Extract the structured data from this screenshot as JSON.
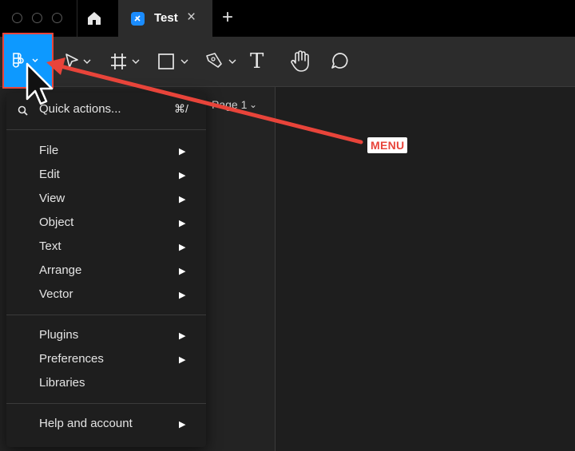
{
  "tabbar": {
    "tab_title": "Test",
    "close_glyph": "×",
    "new_tab_glyph": "+"
  },
  "toolbar": {
    "icons": [
      "figma-logo-icon",
      "move-tool-icon",
      "frame-tool-icon",
      "shape-tool-icon",
      "pen-tool-icon",
      "text-tool-icon",
      "hand-tool-icon",
      "comment-tool-icon"
    ],
    "text_tool_glyph": "T"
  },
  "pages": {
    "current": "Page 1"
  },
  "menu": {
    "search_label": "Quick actions...",
    "search_shortcut": "⌘/",
    "group1": [
      "File",
      "Edit",
      "View",
      "Object",
      "Text",
      "Arrange",
      "Vector"
    ],
    "group2": [
      "Plugins",
      "Preferences",
      "Libraries"
    ],
    "group3": [
      "Help and account"
    ]
  },
  "annotation": {
    "label": "MENU"
  },
  "colors": {
    "accent": "#0d99ff",
    "highlight": "#e8443a",
    "background": "#1e1e1e",
    "toolbar": "#2c2c2c"
  }
}
